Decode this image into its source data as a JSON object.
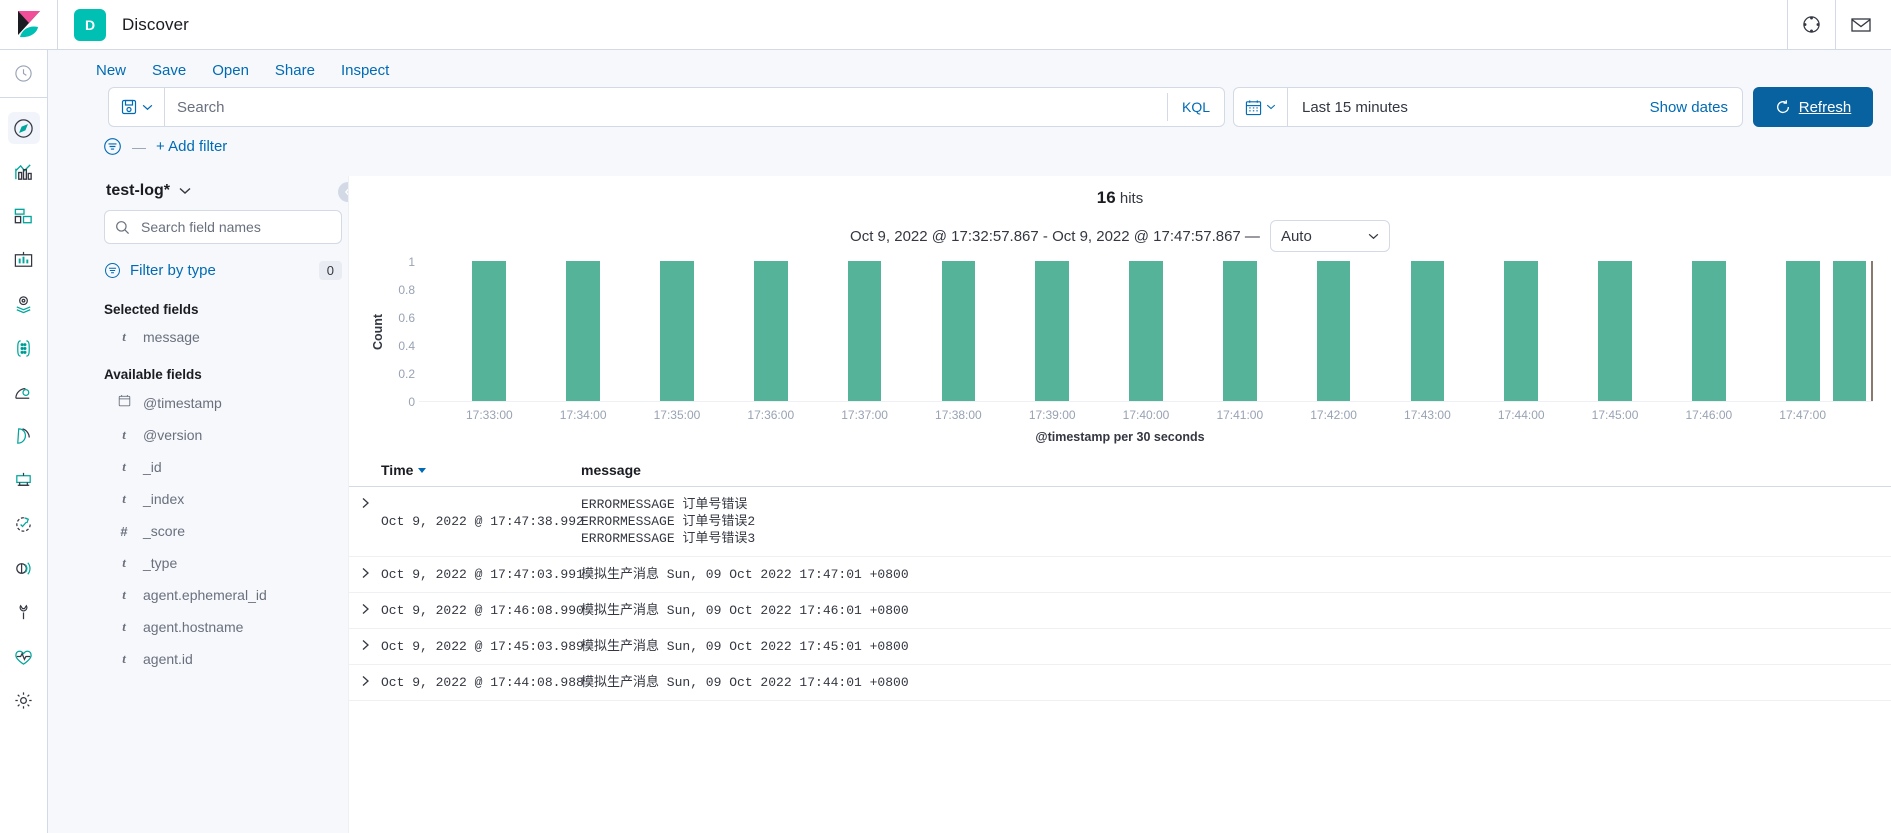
{
  "header": {
    "app_badge": "D",
    "title": "Discover",
    "icons": [
      "help-circle-icon",
      "mail-icon"
    ]
  },
  "rail": {
    "recent_icon": "clock-icon",
    "items": [
      {
        "name": "discover",
        "icon": "compass-icon",
        "active": true
      },
      {
        "name": "visualize",
        "icon": "bar-chart-icon",
        "active": false
      },
      {
        "name": "dashboard",
        "icon": "dashboard-icon",
        "active": false
      },
      {
        "name": "canvas",
        "icon": "canvas-icon",
        "active": false
      },
      {
        "name": "maps",
        "icon": "map-marker-icon",
        "active": false
      },
      {
        "name": "machine-learning",
        "icon": "ml-nodes-icon",
        "active": false
      },
      {
        "name": "infrastructure",
        "icon": "infra-icon",
        "active": false
      },
      {
        "name": "logs",
        "icon": "logs-icon",
        "active": false
      },
      {
        "name": "apm",
        "icon": "apm-icon",
        "active": false
      },
      {
        "name": "uptime",
        "icon": "uptime-icon",
        "active": false
      },
      {
        "name": "siem",
        "icon": "siem-icon",
        "active": false
      },
      {
        "name": "dev-tools",
        "icon": "wrench-icon",
        "active": false
      },
      {
        "name": "monitoring",
        "icon": "heartbeat-icon",
        "active": false
      },
      {
        "name": "management",
        "icon": "gear-icon",
        "active": false
      }
    ]
  },
  "topnav": {
    "menu": [
      "New",
      "Save",
      "Open",
      "Share",
      "Inspect"
    ],
    "saved_query_icon": "save-disk-icon",
    "search": {
      "value": "",
      "placeholder": "Search"
    },
    "query_language": "KQL",
    "time": {
      "calendar_icon": "calendar-icon",
      "label": "Last 15 minutes",
      "show_dates": "Show dates"
    },
    "refresh": {
      "label": "Refresh",
      "icon": "refresh-icon"
    },
    "filter": {
      "icon": "filter-icon",
      "dash": "—",
      "add_label": "+ Add filter"
    }
  },
  "sidebar": {
    "index_pattern": "test-log*",
    "index_chevron": "chevron-down-icon",
    "field_search": {
      "value": "",
      "placeholder": "Search field names",
      "icon": "search-icon"
    },
    "filter_by_type": {
      "label": "Filter by type",
      "icon": "filter-icon",
      "count": "0"
    },
    "selected_fields_title": "Selected fields",
    "selected_fields": [
      {
        "type": "t",
        "name": "message"
      }
    ],
    "available_fields_title": "Available fields",
    "available_fields": [
      {
        "type": "cal",
        "name": "@timestamp"
      },
      {
        "type": "t",
        "name": "@version"
      },
      {
        "type": "t",
        "name": "_id"
      },
      {
        "type": "t",
        "name": "_index"
      },
      {
        "type": "#",
        "name": "_score"
      },
      {
        "type": "t",
        "name": "_type"
      },
      {
        "type": "t",
        "name": "agent.ephemeral_id"
      },
      {
        "type": "t",
        "name": "agent.hostname"
      },
      {
        "type": "t",
        "name": "agent.id"
      }
    ],
    "collapse_icon": "chevron-left-icon"
  },
  "main": {
    "hits_count": "16",
    "hits_label": "hits",
    "range_text": "Oct 9, 2022 @ 17:32:57.867 - Oct 9, 2022 @ 17:47:57.867 —",
    "interval": "Auto",
    "interval_chevron": "chevron-down-icon"
  },
  "chart_data": {
    "type": "bar",
    "title": "",
    "xlabel": "@timestamp per 30 seconds",
    "ylabel": "Count",
    "ylim": [
      0,
      1
    ],
    "yticks": [
      0,
      0.2,
      0.4,
      0.6,
      0.8,
      1
    ],
    "ytick_labels": [
      "0",
      "0.2",
      "0.4",
      "0.6",
      "0.8",
      "1"
    ],
    "grid": false,
    "legend": "none",
    "bar_color": "#54b399",
    "x_start": "17:32:30",
    "x_end": "17:48:00",
    "xtick_labels": [
      "17:33:00",
      "17:34:00",
      "17:35:00",
      "17:36:00",
      "17:37:00",
      "17:38:00",
      "17:39:00",
      "17:40:00",
      "17:41:00",
      "17:42:00",
      "17:43:00",
      "17:44:00",
      "17:45:00",
      "17:46:00",
      "17:47:00"
    ],
    "bucket_seconds": 30,
    "categories": [
      "17:32:30",
      "17:33:00",
      "17:33:30",
      "17:34:00",
      "17:34:30",
      "17:35:00",
      "17:35:30",
      "17:36:00",
      "17:36:30",
      "17:37:00",
      "17:37:30",
      "17:38:00",
      "17:38:30",
      "17:39:00",
      "17:39:30",
      "17:40:00",
      "17:40:30",
      "17:41:00",
      "17:41:30",
      "17:42:00",
      "17:42:30",
      "17:43:00",
      "17:43:30",
      "17:44:00",
      "17:44:30",
      "17:45:00",
      "17:45:30",
      "17:46:00",
      "17:46:30",
      "17:47:00",
      "17:47:30"
    ],
    "values": [
      0,
      1,
      0,
      1,
      0,
      1,
      0,
      1,
      0,
      1,
      0,
      1,
      0,
      1,
      0,
      1,
      0,
      1,
      0,
      1,
      0,
      1,
      0,
      1,
      0,
      1,
      0,
      1,
      0,
      1,
      1
    ]
  },
  "table": {
    "columns": [
      "Time",
      "message"
    ],
    "sort_icon": "caret-down-icon",
    "expand_icon": "chevron-right-icon",
    "rows": [
      {
        "time": "Oct 9, 2022 @ 17:47:38.992",
        "message_lines": [
          "ERRORMESSAGE 订单号错误",
          "ERRORMESSAGE 订单号错误2",
          "ERRORMESSAGE 订单号错误3"
        ]
      },
      {
        "time": "Oct 9, 2022 @ 17:47:03.991",
        "message_lines": [
          "模拟生产消息  Sun, 09 Oct 2022 17:47:01 +0800"
        ]
      },
      {
        "time": "Oct 9, 2022 @ 17:46:08.990",
        "message_lines": [
          "模拟生产消息  Sun, 09 Oct 2022 17:46:01 +0800"
        ]
      },
      {
        "time": "Oct 9, 2022 @ 17:45:03.989",
        "message_lines": [
          "模拟生产消息  Sun, 09 Oct 2022 17:45:01 +0800"
        ]
      },
      {
        "time": "Oct 9, 2022 @ 17:44:08.988",
        "message_lines": [
          "模拟生产消息  Sun, 09 Oct 2022 17:44:01 +0800"
        ]
      }
    ]
  },
  "colors": {
    "accent": "#006bb4",
    "primary_button": "#07629f",
    "bar": "#54b399",
    "badge": "#00bfb3",
    "page_bg": "#f7f8fc"
  }
}
